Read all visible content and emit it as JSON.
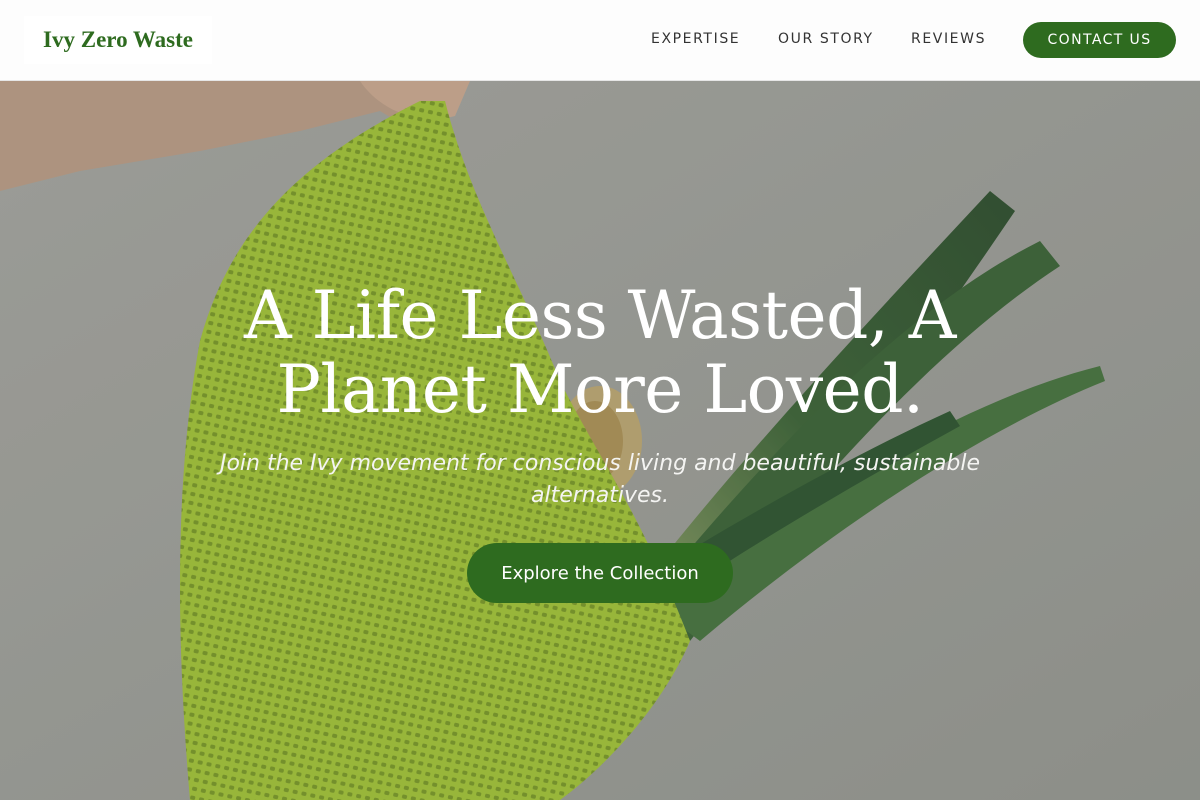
{
  "header": {
    "logo_text": "Ivy Zero Waste",
    "nav": [
      {
        "label": "EXPERTISE"
      },
      {
        "label": "OUR STORY"
      },
      {
        "label": "REVIEWS"
      }
    ],
    "contact_label": "CONTACT US"
  },
  "hero": {
    "headline": "A Life Less Wasted, A Planet More Loved.",
    "subtitle": "Join the Ivy movement for conscious living and beautiful, sustainable alternatives.",
    "cta_label": "Explore the Collection",
    "background_image": "green-mesh-bag-with-leeks"
  },
  "colors": {
    "brand_green": "#2e6b1f",
    "header_bg": "#fdfdfd",
    "hero_wall": "#a7a9a3",
    "mesh_green": "#9cc431"
  }
}
